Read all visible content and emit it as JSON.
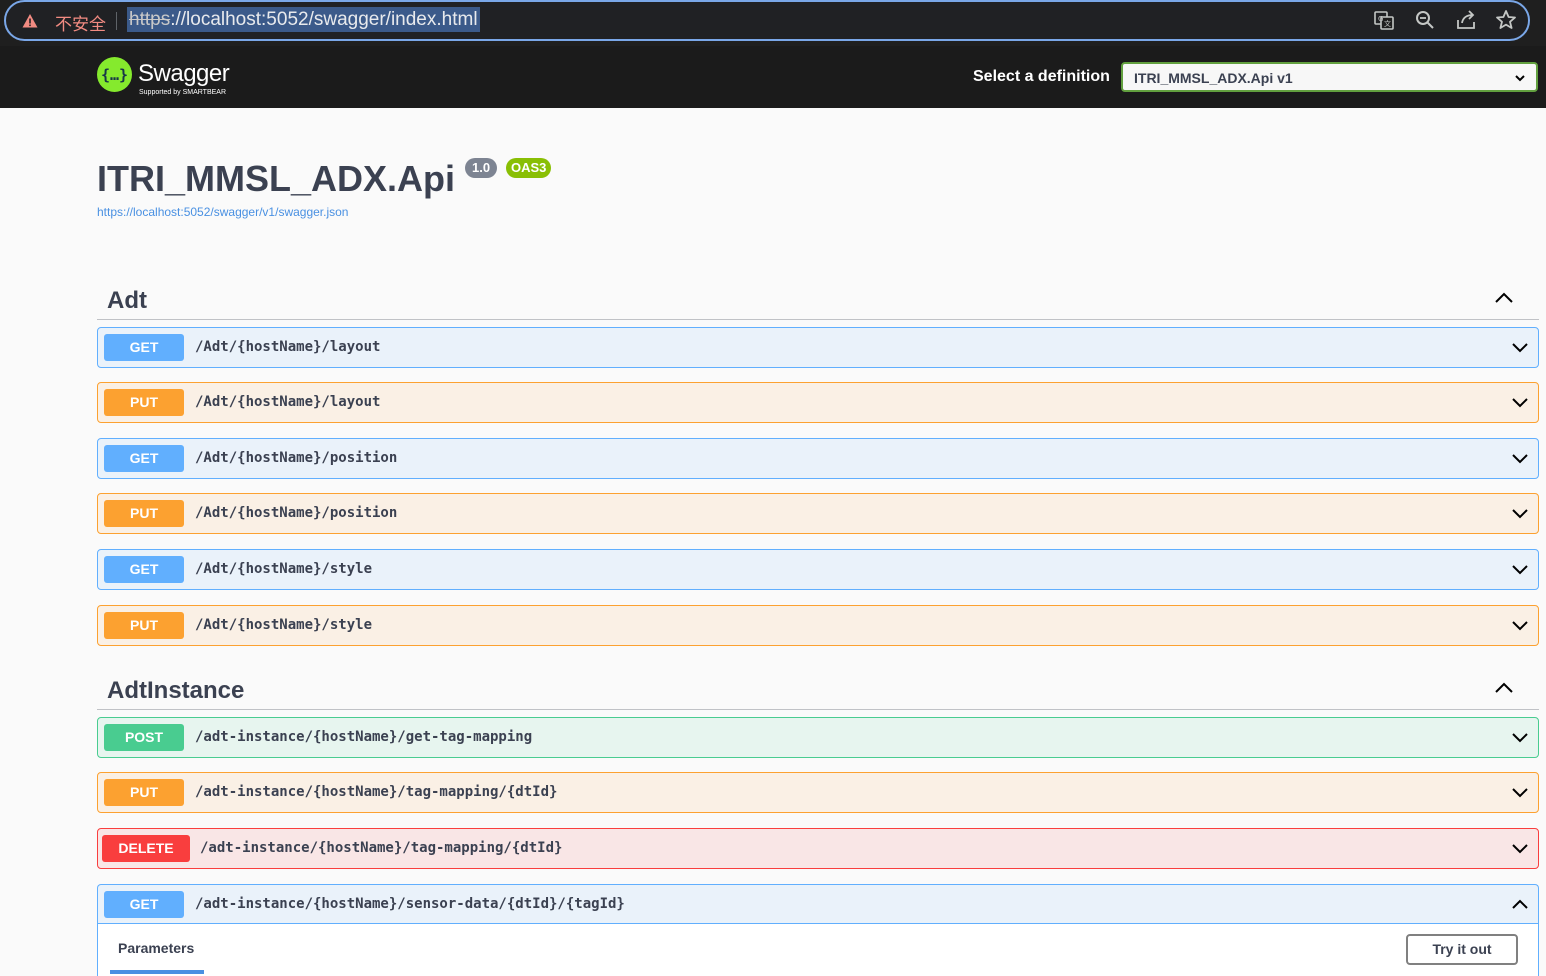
{
  "browser": {
    "security_text": "不安全",
    "url_scheme": "https",
    "url_rest": "://localhost:5052/swagger/index.html"
  },
  "topbar": {
    "logo_text": "Swagger",
    "logo_sub": "Supported by SMARTBEAR",
    "select_label": "Select a definition",
    "selected_definition": "ITRI_MMSL_ADX.Api v1"
  },
  "info": {
    "title": "ITRI_MMSL_ADX.Api",
    "version": "1.0",
    "oas": "OAS3",
    "spec_url": "https://localhost:5052/swagger/v1/swagger.json"
  },
  "tags": [
    {
      "name": "Adt",
      "expanded": true,
      "operations": [
        {
          "method": "GET",
          "path": "/Adt/{hostName}/layout"
        },
        {
          "method": "PUT",
          "path": "/Adt/{hostName}/layout"
        },
        {
          "method": "GET",
          "path": "/Adt/{hostName}/position"
        },
        {
          "method": "PUT",
          "path": "/Adt/{hostName}/position"
        },
        {
          "method": "GET",
          "path": "/Adt/{hostName}/style"
        },
        {
          "method": "PUT",
          "path": "/Adt/{hostName}/style"
        }
      ]
    },
    {
      "name": "AdtInstance",
      "expanded": true,
      "operations": [
        {
          "method": "POST",
          "path": "/adt-instance/{hostName}/get-tag-mapping"
        },
        {
          "method": "PUT",
          "path": "/adt-instance/{hostName}/tag-mapping/{dtId}"
        },
        {
          "method": "DELETE",
          "path": "/adt-instance/{hostName}/tag-mapping/{dtId}"
        },
        {
          "method": "GET",
          "path": "/adt-instance/{hostName}/sensor-data/{dtId}/{tagId}"
        }
      ]
    }
  ],
  "expanded_operation": {
    "params_tab_label": "Parameters",
    "try_button_label": "Try it out"
  },
  "colors": {
    "get": "#61affe",
    "put": "#fca130",
    "post": "#49cc90",
    "delete": "#f93e3e",
    "swagger_green": "#85ea2d"
  }
}
